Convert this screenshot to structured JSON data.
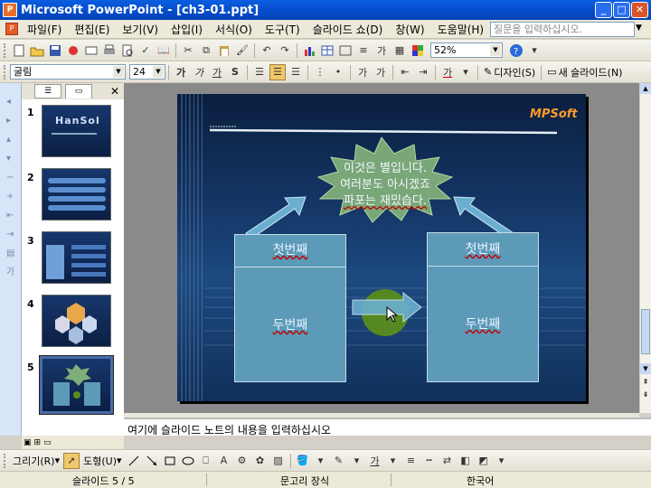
{
  "window": {
    "title": "Microsoft PowerPoint - [ch3-01.ppt]"
  },
  "menu": {
    "items": [
      "파일(F)",
      "편집(E)",
      "보기(V)",
      "삽입(I)",
      "서식(O)",
      "도구(T)",
      "슬라이드 쇼(D)",
      "창(W)",
      "도움말(H)"
    ],
    "ask_placeholder": "질문을 입력하십시오."
  },
  "toolbar1": {
    "zoom": "52%"
  },
  "toolbar2": {
    "font": "굴림",
    "size": "24",
    "bold": "가",
    "italic": "가",
    "underline": "가",
    "shadow": "S",
    "font_color": "가",
    "design": "디자인(S)",
    "new_slide": "새 슬라이드(N)"
  },
  "slides_pane": {
    "thumbs": [
      {
        "num": "1",
        "title": "HanSol"
      },
      {
        "num": "2"
      },
      {
        "num": "3"
      },
      {
        "num": "4"
      },
      {
        "num": "5"
      }
    ],
    "selected": 5
  },
  "slide": {
    "logo": "MPSoft",
    "star_lines": [
      "이것은 별입니다.",
      "여러분도 아시겠죠",
      "파포는 재밌습다."
    ],
    "left_top": "첫번째",
    "left_bottom": "두번째",
    "right_top": "첫번째",
    "right_bottom": "두번째"
  },
  "notes": {
    "placeholder": "여기에 슬라이드 노트의 내용을 입력하십시오"
  },
  "drawbar": {
    "draw": "그리기(R)",
    "autoshapes": "도형(U)",
    "font_color": "가"
  },
  "status": {
    "slide": "슬라이드 5 / 5",
    "design": "문고리 장식",
    "language": "한국어"
  },
  "colors": {
    "title_bar": "#0550d0",
    "slide_bg": "#143565",
    "box_fill": "#5c9ab8",
    "star_fill": "#7fae7a",
    "circle": "#5a8c1c"
  }
}
